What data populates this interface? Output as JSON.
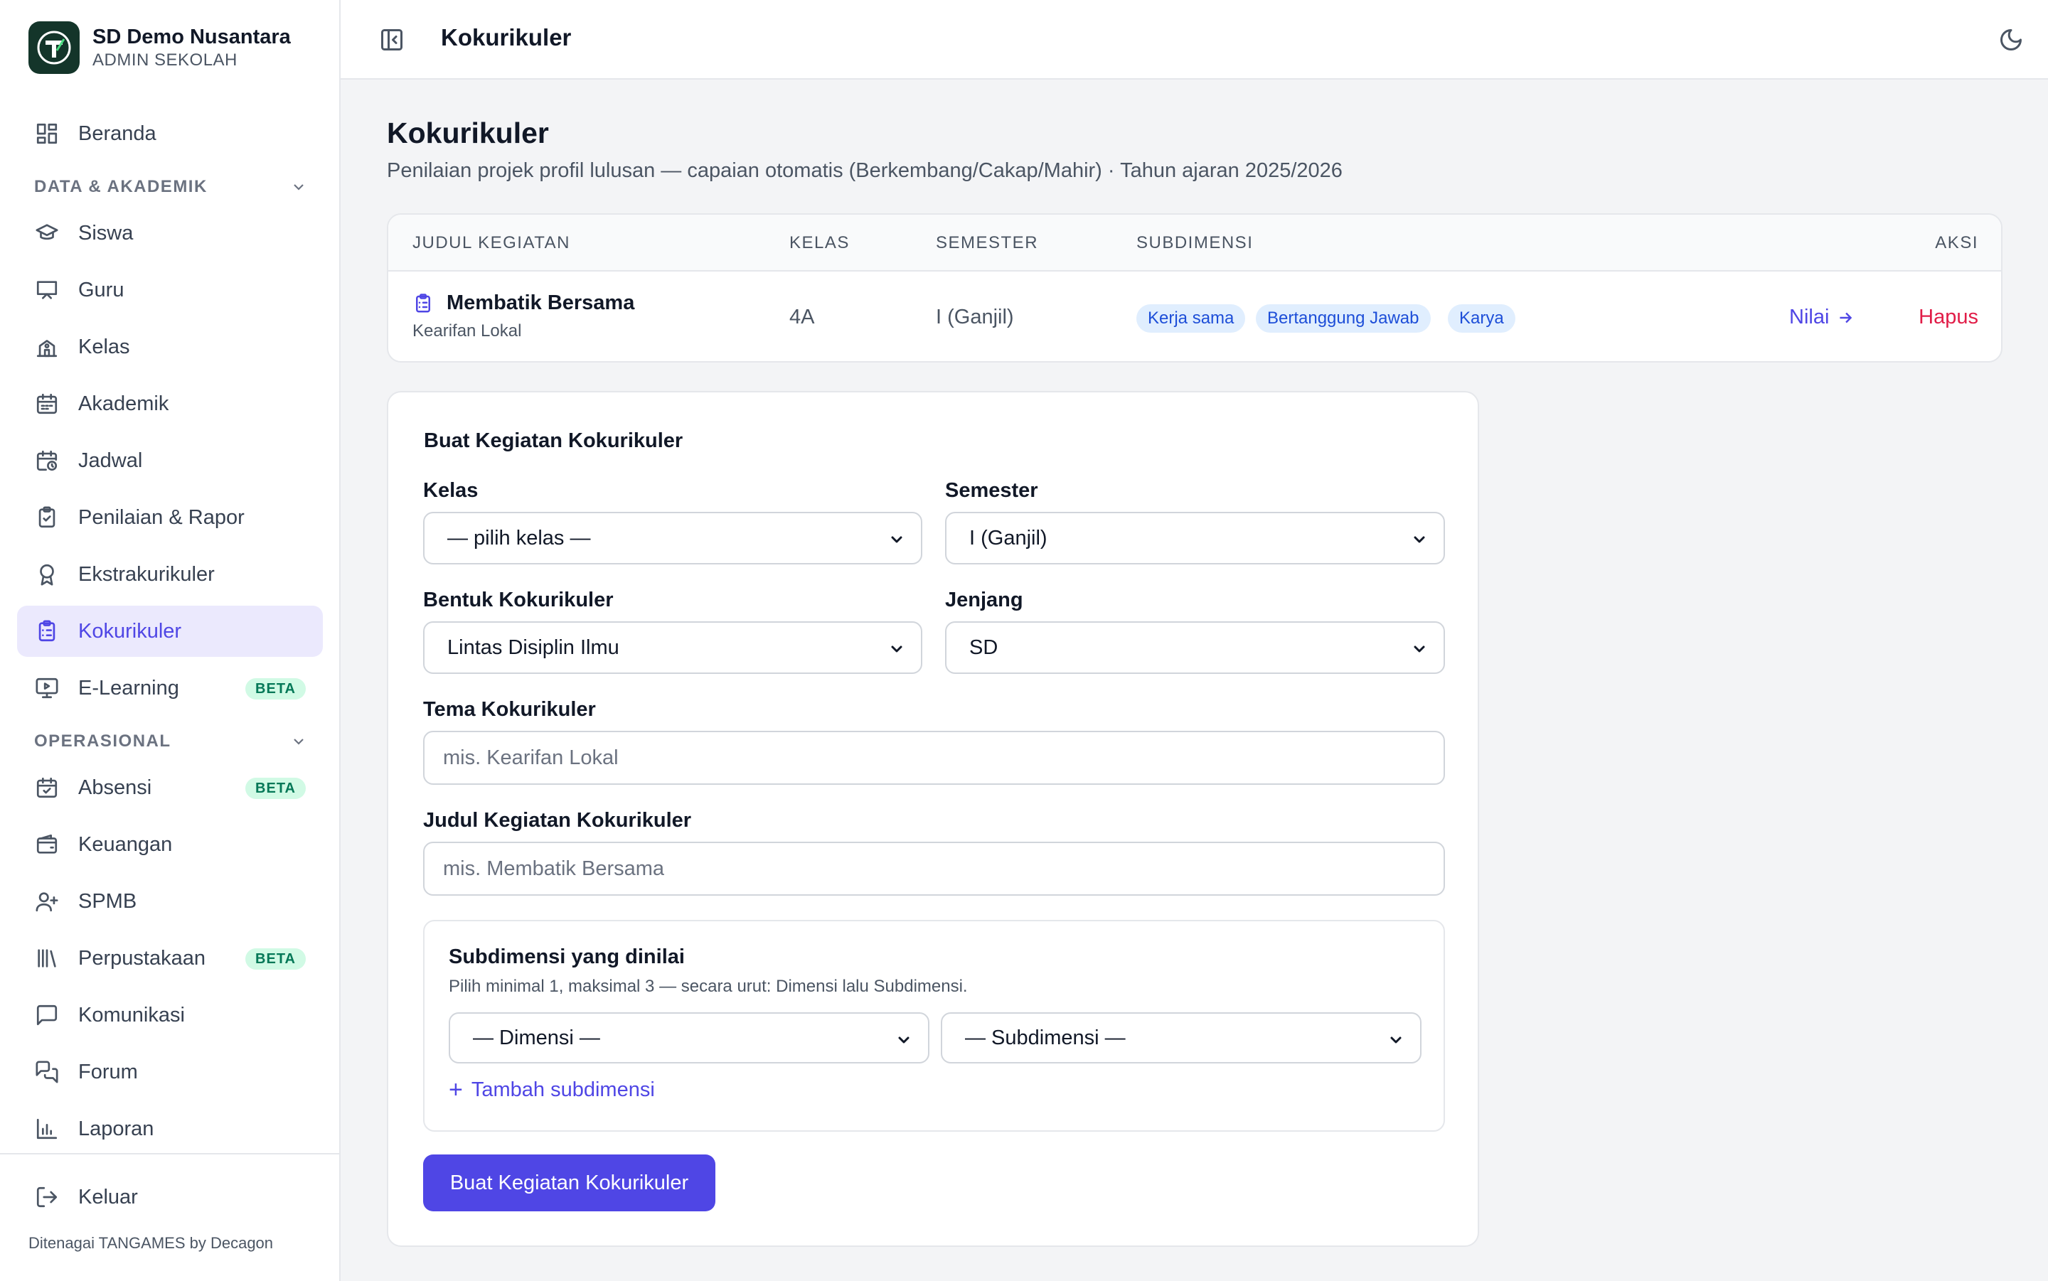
{
  "brand": {
    "name": "SD Demo Nusantara",
    "role": "ADMIN SEKOLAH"
  },
  "sidebar": {
    "home": "Beranda",
    "section_academic": "DATA & AKADEMIK",
    "academic_items": [
      "Siswa",
      "Guru",
      "Kelas",
      "Akademik",
      "Jadwal",
      "Penilaian & Rapor",
      "Ekstrakurikuler",
      "Kokurikuler",
      "E-Learning"
    ],
    "section_operational": "OPERASIONAL",
    "operational_items": [
      "Absensi",
      "Keuangan",
      "SPMB",
      "Perpustakaan",
      "Komunikasi",
      "Forum",
      "Laporan"
    ],
    "badge": "BETA",
    "logout": "Keluar",
    "footer": "Ditenagai TANGAMES by Decagon"
  },
  "topbar": {
    "title": "Kokurikuler"
  },
  "page": {
    "title": "Kokurikuler",
    "subtitle": "Penilaian projek profil lulusan — capaian otomatis (Berkembang/Cakap/Mahir) · Tahun ajaran 2025/2026"
  },
  "table": {
    "headers": {
      "title": "JUDUL KEGIATAN",
      "class": "KELAS",
      "semester": "SEMESTER",
      "subdimension": "SUBDIMENSI",
      "action": "AKSI"
    },
    "row": {
      "title": "Membatik Bersama",
      "theme": "Kearifan Lokal",
      "class": "4A",
      "semester": "I (Ganjil)",
      "tags": [
        "Kerja sama",
        "Bertanggung Jawab",
        "Karya"
      ],
      "action_grade": "Nilai",
      "action_delete": "Hapus"
    }
  },
  "form": {
    "heading": "Buat Kegiatan Kokurikuler",
    "class_label": "Kelas",
    "class_value": "— pilih kelas —",
    "semester_label": "Semester",
    "semester_value": "I (Ganjil)",
    "form_label": "Bentuk Kokurikuler",
    "form_value": "Lintas Disiplin Ilmu",
    "level_label": "Jenjang",
    "level_value": "SD",
    "theme_label": "Tema Kokurikuler",
    "theme_placeholder": "mis. Kearifan Lokal",
    "activity_label": "Judul Kegiatan Kokurikuler",
    "activity_placeholder": "mis. Membatik Bersama",
    "subdim_title": "Subdimensi yang dinilai",
    "subdim_hint": "Pilih minimal 1, maksimal 3 — secara urut: Dimensi lalu Subdimensi.",
    "dimension_value": "— Dimensi —",
    "subdimension_value": "— Subdimensi —",
    "add_subdim": "Tambah subdimensi",
    "submit": "Buat Kegiatan Kokurikuler"
  },
  "colors": {
    "accent": "#4f46e5",
    "danger": "#e11d48",
    "brand_bg": "#14352a"
  }
}
